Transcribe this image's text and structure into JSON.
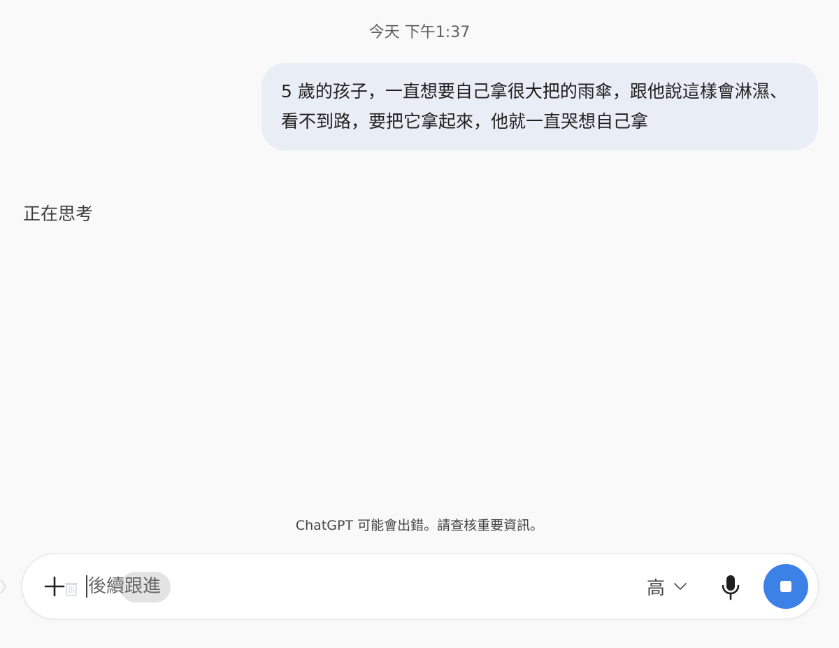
{
  "header": {
    "timestamp": "今天 下午1:37"
  },
  "messages": [
    {
      "role": "user",
      "text": "5 歲的孩子，一直想要自己拿很大把的雨傘，跟他說這樣會淋濕、看不到路，要把它拿起來，他就一直哭想自己拿"
    }
  ],
  "assistant": {
    "status_text": "正在思考"
  },
  "footer": {
    "disclaimer": "ChatGPT 可能會出錯。請查核重要資訊。"
  },
  "composer": {
    "input_value": "後續跟進",
    "model_label": "高",
    "icons": {
      "attach": "plus-icon",
      "mic": "microphone-icon",
      "stop": "stop-icon",
      "dropdown": "chevron-down-icon"
    },
    "colors": {
      "stop_button": "#3c82e6"
    }
  }
}
